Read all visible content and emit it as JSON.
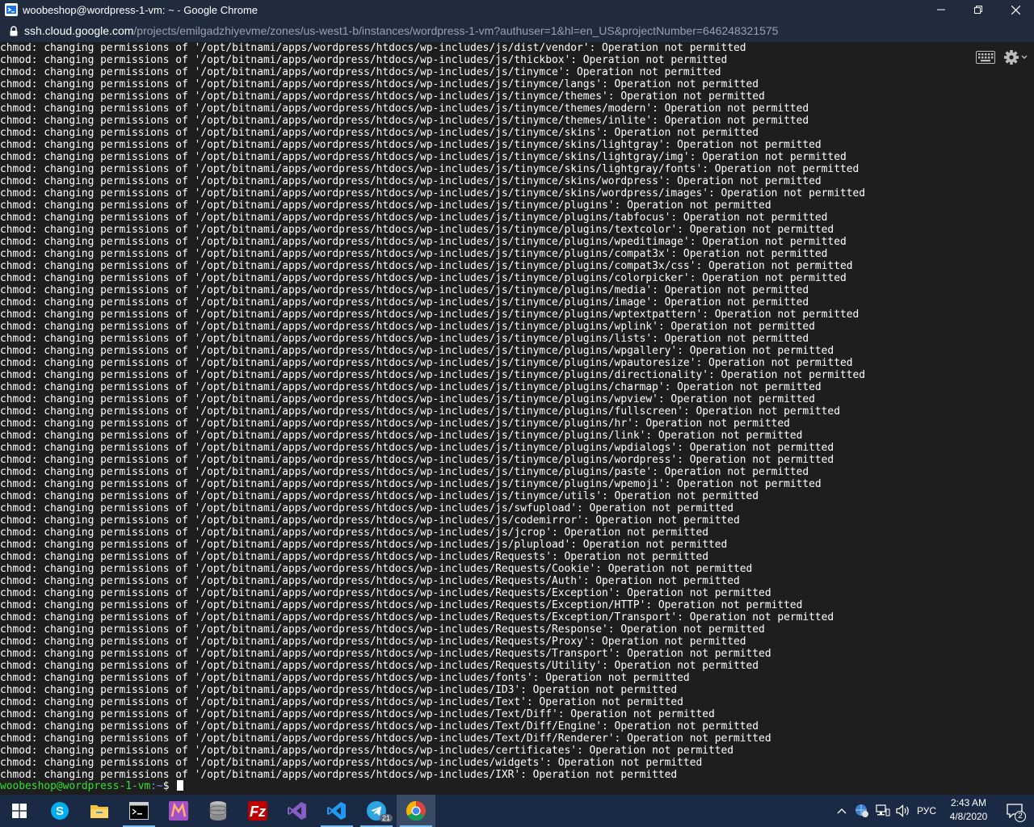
{
  "window": {
    "title": "woobeshop@wordpress-1-vm: ~ - Google Chrome"
  },
  "urlbar": {
    "host": "ssh.cloud.google.com",
    "path": "/projects/emilgadzhiyevme/zones/us-west1-b/instances/wordpress-1-vm?authuser=1&hl=en_US&projectNumber=646248321575"
  },
  "terminal": {
    "lines": [
      "chmod: changing permissions of '/opt/bitnami/apps/wordpress/htdocs/wp-includes/js/dist/vendor': Operation not permitted",
      "chmod: changing permissions of '/opt/bitnami/apps/wordpress/htdocs/wp-includes/js/thickbox': Operation not permitted",
      "chmod: changing permissions of '/opt/bitnami/apps/wordpress/htdocs/wp-includes/js/tinymce': Operation not permitted",
      "chmod: changing permissions of '/opt/bitnami/apps/wordpress/htdocs/wp-includes/js/tinymce/langs': Operation not permitted",
      "chmod: changing permissions of '/opt/bitnami/apps/wordpress/htdocs/wp-includes/js/tinymce/themes': Operation not permitted",
      "chmod: changing permissions of '/opt/bitnami/apps/wordpress/htdocs/wp-includes/js/tinymce/themes/modern': Operation not permitted",
      "chmod: changing permissions of '/opt/bitnami/apps/wordpress/htdocs/wp-includes/js/tinymce/themes/inlite': Operation not permitted",
      "chmod: changing permissions of '/opt/bitnami/apps/wordpress/htdocs/wp-includes/js/tinymce/skins': Operation not permitted",
      "chmod: changing permissions of '/opt/bitnami/apps/wordpress/htdocs/wp-includes/js/tinymce/skins/lightgray': Operation not permitted",
      "chmod: changing permissions of '/opt/bitnami/apps/wordpress/htdocs/wp-includes/js/tinymce/skins/lightgray/img': Operation not permitted",
      "chmod: changing permissions of '/opt/bitnami/apps/wordpress/htdocs/wp-includes/js/tinymce/skins/lightgray/fonts': Operation not permitted",
      "chmod: changing permissions of '/opt/bitnami/apps/wordpress/htdocs/wp-includes/js/tinymce/skins/wordpress': Operation not permitted",
      "chmod: changing permissions of '/opt/bitnami/apps/wordpress/htdocs/wp-includes/js/tinymce/skins/wordpress/images': Operation not permitted",
      "chmod: changing permissions of '/opt/bitnami/apps/wordpress/htdocs/wp-includes/js/tinymce/plugins': Operation not permitted",
      "chmod: changing permissions of '/opt/bitnami/apps/wordpress/htdocs/wp-includes/js/tinymce/plugins/tabfocus': Operation not permitted",
      "chmod: changing permissions of '/opt/bitnami/apps/wordpress/htdocs/wp-includes/js/tinymce/plugins/textcolor': Operation not permitted",
      "chmod: changing permissions of '/opt/bitnami/apps/wordpress/htdocs/wp-includes/js/tinymce/plugins/wpeditimage': Operation not permitted",
      "chmod: changing permissions of '/opt/bitnami/apps/wordpress/htdocs/wp-includes/js/tinymce/plugins/compat3x': Operation not permitted",
      "chmod: changing permissions of '/opt/bitnami/apps/wordpress/htdocs/wp-includes/js/tinymce/plugins/compat3x/css': Operation not permitted",
      "chmod: changing permissions of '/opt/bitnami/apps/wordpress/htdocs/wp-includes/js/tinymce/plugins/colorpicker': Operation not permitted",
      "chmod: changing permissions of '/opt/bitnami/apps/wordpress/htdocs/wp-includes/js/tinymce/plugins/media': Operation not permitted",
      "chmod: changing permissions of '/opt/bitnami/apps/wordpress/htdocs/wp-includes/js/tinymce/plugins/image': Operation not permitted",
      "chmod: changing permissions of '/opt/bitnami/apps/wordpress/htdocs/wp-includes/js/tinymce/plugins/wptextpattern': Operation not permitted",
      "chmod: changing permissions of '/opt/bitnami/apps/wordpress/htdocs/wp-includes/js/tinymce/plugins/wplink': Operation not permitted",
      "chmod: changing permissions of '/opt/bitnami/apps/wordpress/htdocs/wp-includes/js/tinymce/plugins/lists': Operation not permitted",
      "chmod: changing permissions of '/opt/bitnami/apps/wordpress/htdocs/wp-includes/js/tinymce/plugins/wpgallery': Operation not permitted",
      "chmod: changing permissions of '/opt/bitnami/apps/wordpress/htdocs/wp-includes/js/tinymce/plugins/wpautoresize': Operation not permitted",
      "chmod: changing permissions of '/opt/bitnami/apps/wordpress/htdocs/wp-includes/js/tinymce/plugins/directionality': Operation not permitted",
      "chmod: changing permissions of '/opt/bitnami/apps/wordpress/htdocs/wp-includes/js/tinymce/plugins/charmap': Operation not permitted",
      "chmod: changing permissions of '/opt/bitnami/apps/wordpress/htdocs/wp-includes/js/tinymce/plugins/wpview': Operation not permitted",
      "chmod: changing permissions of '/opt/bitnami/apps/wordpress/htdocs/wp-includes/js/tinymce/plugins/fullscreen': Operation not permitted",
      "chmod: changing permissions of '/opt/bitnami/apps/wordpress/htdocs/wp-includes/js/tinymce/plugins/hr': Operation not permitted",
      "chmod: changing permissions of '/opt/bitnami/apps/wordpress/htdocs/wp-includes/js/tinymce/plugins/link': Operation not permitted",
      "chmod: changing permissions of '/opt/bitnami/apps/wordpress/htdocs/wp-includes/js/tinymce/plugins/wpdialogs': Operation not permitted",
      "chmod: changing permissions of '/opt/bitnami/apps/wordpress/htdocs/wp-includes/js/tinymce/plugins/wordpress': Operation not permitted",
      "chmod: changing permissions of '/opt/bitnami/apps/wordpress/htdocs/wp-includes/js/tinymce/plugins/paste': Operation not permitted",
      "chmod: changing permissions of '/opt/bitnami/apps/wordpress/htdocs/wp-includes/js/tinymce/plugins/wpemoji': Operation not permitted",
      "chmod: changing permissions of '/opt/bitnami/apps/wordpress/htdocs/wp-includes/js/tinymce/utils': Operation not permitted",
      "chmod: changing permissions of '/opt/bitnami/apps/wordpress/htdocs/wp-includes/js/swfupload': Operation not permitted",
      "chmod: changing permissions of '/opt/bitnami/apps/wordpress/htdocs/wp-includes/js/codemirror': Operation not permitted",
      "chmod: changing permissions of '/opt/bitnami/apps/wordpress/htdocs/wp-includes/js/jcrop': Operation not permitted",
      "chmod: changing permissions of '/opt/bitnami/apps/wordpress/htdocs/wp-includes/js/plupload': Operation not permitted",
      "chmod: changing permissions of '/opt/bitnami/apps/wordpress/htdocs/wp-includes/Requests': Operation not permitted",
      "chmod: changing permissions of '/opt/bitnami/apps/wordpress/htdocs/wp-includes/Requests/Cookie': Operation not permitted",
      "chmod: changing permissions of '/opt/bitnami/apps/wordpress/htdocs/wp-includes/Requests/Auth': Operation not permitted",
      "chmod: changing permissions of '/opt/bitnami/apps/wordpress/htdocs/wp-includes/Requests/Exception': Operation not permitted",
      "chmod: changing permissions of '/opt/bitnami/apps/wordpress/htdocs/wp-includes/Requests/Exception/HTTP': Operation not permitted",
      "chmod: changing permissions of '/opt/bitnami/apps/wordpress/htdocs/wp-includes/Requests/Exception/Transport': Operation not permitted",
      "chmod: changing permissions of '/opt/bitnami/apps/wordpress/htdocs/wp-includes/Requests/Response': Operation not permitted",
      "chmod: changing permissions of '/opt/bitnami/apps/wordpress/htdocs/wp-includes/Requests/Proxy': Operation not permitted",
      "chmod: changing permissions of '/opt/bitnami/apps/wordpress/htdocs/wp-includes/Requests/Transport': Operation not permitted",
      "chmod: changing permissions of '/opt/bitnami/apps/wordpress/htdocs/wp-includes/Requests/Utility': Operation not permitted",
      "chmod: changing permissions of '/opt/bitnami/apps/wordpress/htdocs/wp-includes/fonts': Operation not permitted",
      "chmod: changing permissions of '/opt/bitnami/apps/wordpress/htdocs/wp-includes/ID3': Operation not permitted",
      "chmod: changing permissions of '/opt/bitnami/apps/wordpress/htdocs/wp-includes/Text': Operation not permitted",
      "chmod: changing permissions of '/opt/bitnami/apps/wordpress/htdocs/wp-includes/Text/Diff': Operation not permitted",
      "chmod: changing permissions of '/opt/bitnami/apps/wordpress/htdocs/wp-includes/Text/Diff/Engine': Operation not permitted",
      "chmod: changing permissions of '/opt/bitnami/apps/wordpress/htdocs/wp-includes/Text/Diff/Renderer': Operation not permitted",
      "chmod: changing permissions of '/opt/bitnami/apps/wordpress/htdocs/wp-includes/certificates': Operation not permitted",
      "chmod: changing permissions of '/opt/bitnami/apps/wordpress/htdocs/wp-includes/widgets': Operation not permitted",
      "chmod: changing permissions of '/opt/bitnami/apps/wordpress/htdocs/wp-includes/IXR': Operation not permitted"
    ],
    "prompt": {
      "user": "woobeshop@wordpress-1-vm",
      "path": ":~",
      "symbol": "$ "
    }
  },
  "taskbar": {
    "apps": [
      {
        "name": "skype-icon",
        "color": "#00aff0"
      },
      {
        "name": "file-explorer-icon",
        "color": "#f3c13a"
      },
      {
        "name": "terminal-icon",
        "color": "#000000"
      },
      {
        "name": "mlauncher-icon",
        "color": "#a350c7"
      },
      {
        "name": "database-icon",
        "color": "#8a8a8a"
      },
      {
        "name": "filezilla-icon",
        "color": "#bf0000"
      },
      {
        "name": "visual-studio-icon",
        "color": "#865fc5"
      },
      {
        "name": "vscode-icon",
        "color": "#2196f3"
      },
      {
        "name": "telegram-icon",
        "color": "#2ca5e0"
      },
      {
        "name": "chrome-icon",
        "color": "#4285f4"
      }
    ],
    "telegram_badge": "21",
    "language": "РУС",
    "time": "2:43 AM",
    "date": "4/8/2020",
    "notification_count": "2"
  }
}
